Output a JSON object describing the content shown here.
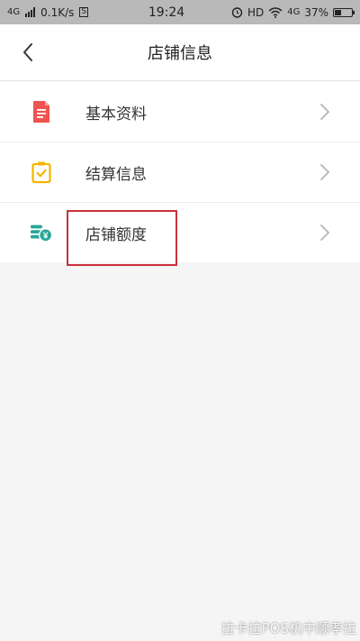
{
  "status_bar": {
    "network_left": "4G",
    "speed": "0.1K/s",
    "sim_badge": "S",
    "time": "19:24",
    "hd_label": "HD",
    "network_right": "4G",
    "battery_percent": "37%",
    "battery_level": 0.37
  },
  "nav": {
    "back_icon": "chevron-left-icon",
    "title": "店铺信息"
  },
  "menu": {
    "items": [
      {
        "label": "基本资料",
        "icon": "document-icon",
        "color": "#ef5350"
      },
      {
        "label": "结算信息",
        "icon": "clipboard-check-icon",
        "color": "#f5b400"
      },
      {
        "label": "店铺额度",
        "icon": "coins-yen-icon",
        "color": "#26a69a"
      }
    ]
  },
  "watermark": "拉卡拉POS机中顺孝拉",
  "colors": {
    "highlight": "#c9303a",
    "status_bar_bg": "#b9b9b9",
    "page_bg": "#f5f5f5"
  }
}
